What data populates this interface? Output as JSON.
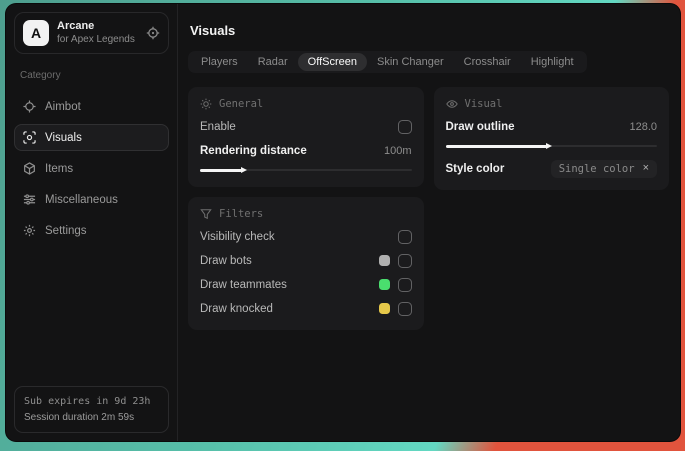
{
  "app": {
    "name": "Arcane",
    "subtitle": "for Apex Legends",
    "logo_letter": "A"
  },
  "sidebar": {
    "category_label": "Category",
    "items": [
      {
        "label": "Aimbot"
      },
      {
        "label": "Visuals"
      },
      {
        "label": "Items"
      },
      {
        "label": "Miscellaneous"
      },
      {
        "label": "Settings"
      }
    ],
    "status": {
      "sub_expires": "Sub expires in 9d 23h",
      "session_duration": "Session duration 2m 59s"
    }
  },
  "main": {
    "title": "Visuals",
    "tabs": [
      {
        "label": "Players"
      },
      {
        "label": "Radar"
      },
      {
        "label": "OffScreen"
      },
      {
        "label": "Skin Changer"
      },
      {
        "label": "Crosshair"
      },
      {
        "label": "Highlight"
      }
    ],
    "panels": {
      "general": {
        "title": "General",
        "enable_label": "Enable",
        "rendering": {
          "label": "Rendering distance",
          "value": "100m",
          "percent": 20
        }
      },
      "filters": {
        "title": "Filters",
        "visibility_label": "Visibility check",
        "bots_label": "Draw bots",
        "teammates_label": "Draw teammates",
        "knocked_label": "Draw knocked"
      },
      "visual": {
        "title": "Visual",
        "outline": {
          "label": "Draw outline",
          "value": "128.0",
          "percent": 48
        },
        "style_color": {
          "label": "Style color",
          "selected": "Single color",
          "clear_glyph": "×"
        }
      }
    }
  },
  "colors": {
    "swatch_bots": "#b0b0b0",
    "swatch_teammates": "#4ade6e",
    "swatch_knocked": "#e6c84a",
    "wallpaper_teal": "#5ac4ae",
    "wallpaper_red": "#e1543d",
    "window_bg": "#131314",
    "panel_bg": "#1b1b1d"
  }
}
